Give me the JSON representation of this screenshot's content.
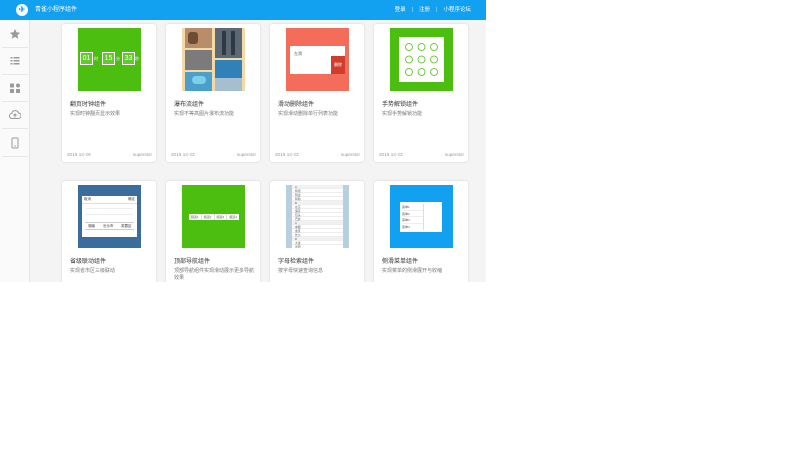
{
  "header": {
    "logo_glyph": "✈",
    "title": "青雀小程序组件",
    "nav": [
      {
        "label": "登录"
      },
      {
        "label": "注册"
      },
      {
        "label": "小程序论坛"
      }
    ],
    "separator": "|"
  },
  "sidebar": {
    "items": [
      {
        "name": "favorites",
        "icon": "star-icon"
      },
      {
        "name": "list",
        "icon": "list-icon"
      },
      {
        "name": "apps",
        "icon": "grid-icon"
      },
      {
        "name": "upload",
        "icon": "cloud-upload-icon"
      },
      {
        "name": "device",
        "icon": "tablet-icon"
      }
    ]
  },
  "cards": [
    {
      "title": "翻页时钟组件",
      "desc": "实现时钟翻页显示效果",
      "date": "2016-12-29",
      "author": "superstor",
      "thumb": {
        "type": "clock",
        "digits": [
          "01",
          "15",
          "33"
        ],
        "units": [
          "时",
          "分",
          "秒"
        ]
      }
    },
    {
      "title": "瀑布流组件",
      "desc": "实现不等高图片瀑布流功能",
      "date": "2016-12-23",
      "author": "superstor",
      "thumb": {
        "type": "waterfall"
      }
    },
    {
      "title": "滑动删除组件",
      "desc": "实现滑动删除单行列表功能",
      "date": "2016-12-23",
      "author": "superstor",
      "thumb": {
        "type": "swipe",
        "item_text": "左滑",
        "action": "删除"
      }
    },
    {
      "title": "手势解锁组件",
      "desc": "实现手势解锁功能",
      "date": "2016-12-23",
      "author": "superstor",
      "thumb": {
        "type": "gesture"
      }
    },
    {
      "title": "省级联动组件",
      "desc": "实现省市区三级联动",
      "date": "",
      "author": "",
      "thumb": {
        "type": "picker",
        "cancel": "取消",
        "confirm": "确定",
        "values": [
          "湖南",
          "长沙市",
          "芙蓉区"
        ]
      }
    },
    {
      "title": "顶部导航组件",
      "desc": "顶部导航组件实现滑动展示更多导航效果",
      "date": "",
      "author": "",
      "thumb": {
        "type": "topnav",
        "tabs": [
          "频道1",
          "频道2",
          "频道3",
          "频道4"
        ]
      }
    },
    {
      "title": "字母检索组件",
      "desc": "按字母快速查询信息",
      "date": "",
      "author": "",
      "thumb": {
        "type": "alphabet",
        "rows": [
          "A",
          "阿坝",
          "阿拉",
          "阿勒",
          "B",
          "北京",
          "保定",
          "包头",
          "巴彦",
          "C",
          "成都",
          "重庆",
          "长沙",
          "D",
          "大连",
          "德阳"
        ]
      }
    },
    {
      "title": "侧滑菜单组件",
      "desc": "实现菜单的侧滑展开与收缩",
      "date": "",
      "author": "",
      "thumb": {
        "type": "sidemenu",
        "items": [
          "菜单1",
          "菜单2",
          "菜单3",
          "菜单4"
        ]
      }
    }
  ],
  "colors": {
    "header": "#12a0f0",
    "green": "#4cbe0f",
    "coral": "#f46d5a",
    "blue": "#12a0f0",
    "slate": "#3a6d9c"
  }
}
